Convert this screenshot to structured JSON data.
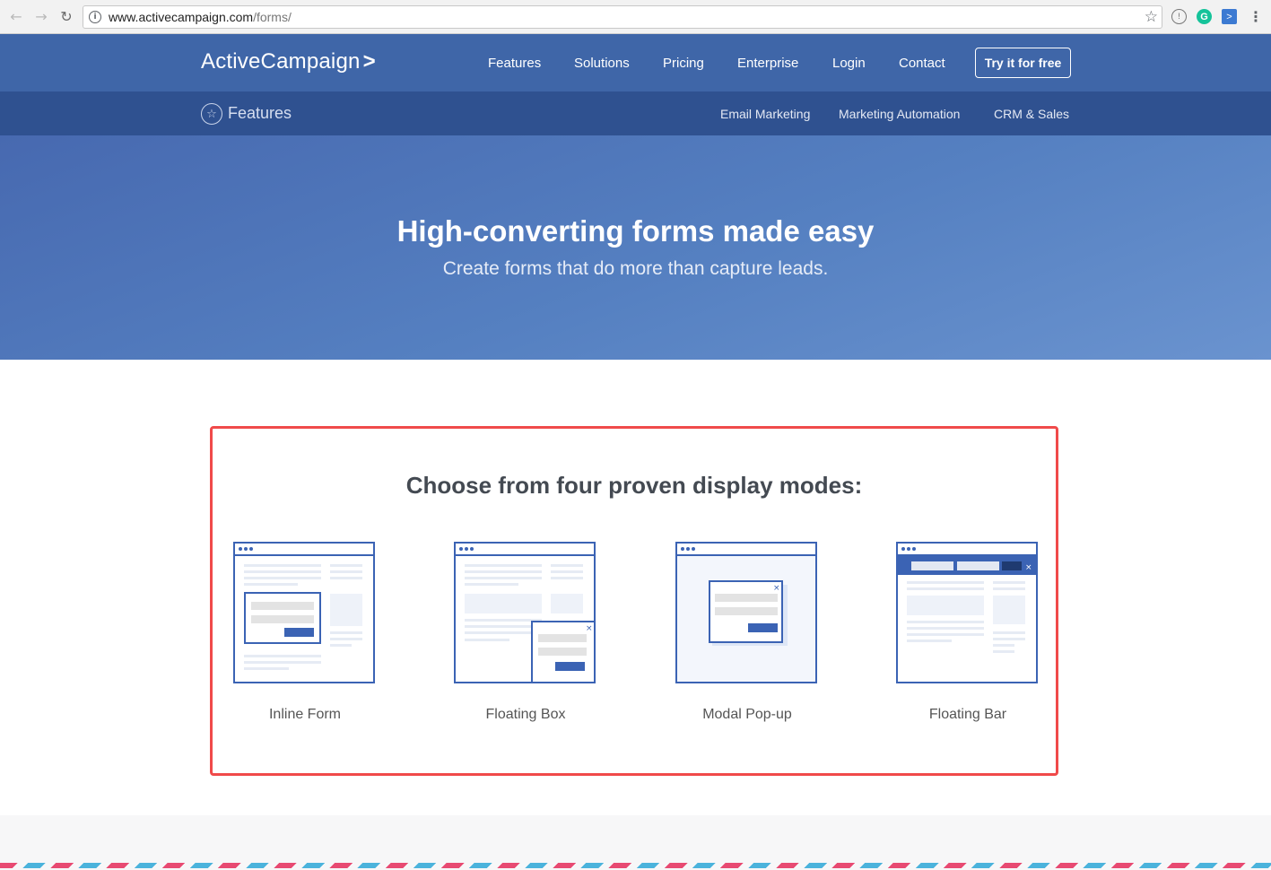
{
  "browser": {
    "url_host": "www.activecampaign.com",
    "url_path": "/forms/"
  },
  "header": {
    "logo_text": "ActiveCampaign",
    "logo_chevron": ">",
    "nav": [
      "Features",
      "Solutions",
      "Pricing",
      "Enterprise",
      "Login",
      "Contact"
    ],
    "cta_label": "Try it for free"
  },
  "subheader": {
    "section_label": "Features",
    "links": [
      "Email Marketing",
      "Marketing Automation",
      "CRM & Sales"
    ]
  },
  "hero": {
    "title": "High-converting forms made easy",
    "subtitle": "Create forms that do more than capture leads."
  },
  "modes": {
    "title": "Choose from four proven display modes:",
    "items": [
      {
        "label": "Inline Form",
        "icon": "inline-form-illustration"
      },
      {
        "label": "Floating Box",
        "icon": "floating-box-illustration"
      },
      {
        "label": "Modal Pop-up",
        "icon": "modal-popup-illustration"
      },
      {
        "label": "Floating Bar",
        "icon": "floating-bar-illustration"
      }
    ]
  },
  "colors": {
    "brand_blue": "#3f66a8",
    "subnav_blue": "#2f5190",
    "highlight_red": "#f04a4a",
    "illustration_blue": "#3b63b4"
  }
}
